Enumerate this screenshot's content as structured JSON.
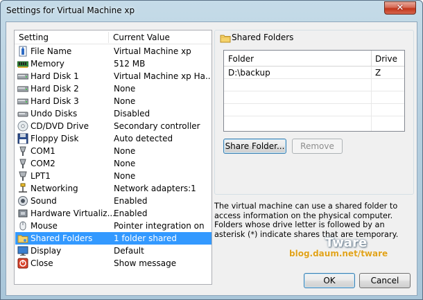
{
  "window": {
    "title": "Settings for Virtual Machine xp",
    "close_label": "✕"
  },
  "settings": {
    "header_setting": "Setting",
    "header_value": "Current Value",
    "items": [
      {
        "label": "File Name",
        "value": "Virtual Machine xp",
        "icon": "file-name-icon"
      },
      {
        "label": "Memory",
        "value": "512 MB",
        "icon": "memory-icon"
      },
      {
        "label": "Hard Disk 1",
        "value": "Virtual Machine xp Ha...",
        "icon": "hard-disk-icon"
      },
      {
        "label": "Hard Disk 2",
        "value": "None",
        "icon": "hard-disk-icon"
      },
      {
        "label": "Hard Disk 3",
        "value": "None",
        "icon": "hard-disk-icon"
      },
      {
        "label": "Undo Disks",
        "value": "Disabled",
        "icon": "undo-disks-icon"
      },
      {
        "label": "CD/DVD Drive",
        "value": "Secondary controller",
        "icon": "cd-dvd-icon"
      },
      {
        "label": "Floppy Disk",
        "value": "Auto detected",
        "icon": "floppy-disk-icon"
      },
      {
        "label": "COM1",
        "value": "None",
        "icon": "com-port-icon"
      },
      {
        "label": "COM2",
        "value": "None",
        "icon": "com-port-icon"
      },
      {
        "label": "LPT1",
        "value": "None",
        "icon": "lpt-port-icon"
      },
      {
        "label": "Networking",
        "value": "Network adapters:1",
        "icon": "network-icon"
      },
      {
        "label": "Sound",
        "value": "Enabled",
        "icon": "sound-icon"
      },
      {
        "label": "Hardware Virtualiz...",
        "value": "Enabled",
        "icon": "hardware-virtualization-icon"
      },
      {
        "label": "Mouse",
        "value": "Pointer integration on",
        "icon": "mouse-icon"
      },
      {
        "label": "Shared Folders",
        "value": "1 folder shared",
        "icon": "shared-folders-icon",
        "selected": true
      },
      {
        "label": "Display",
        "value": "Default",
        "icon": "display-icon"
      },
      {
        "label": "Close",
        "value": "Show message",
        "icon": "close-setting-icon"
      }
    ]
  },
  "shared_folders": {
    "title": "Shared Folders",
    "col_folder": "Folder",
    "col_drive": "Drive",
    "rows": [
      {
        "folder": "D:\\backup",
        "drive": "Z"
      }
    ],
    "share_button": "Share Folder...",
    "remove_button": "Remove",
    "description": "The virtual machine can use a shared folder to access information on the physical computer. Folders whose drive letter is followed by an asterisk (*) indicate shares that are temporary."
  },
  "watermark": {
    "title": "Tware",
    "url": "blog.daum.net/tware"
  },
  "footer": {
    "ok_label": "OK",
    "cancel_label": "Cancel"
  },
  "colors": {
    "selection": "#3399ff",
    "title_gradient": "#b5cfdf",
    "close_button": "#c2361b"
  }
}
